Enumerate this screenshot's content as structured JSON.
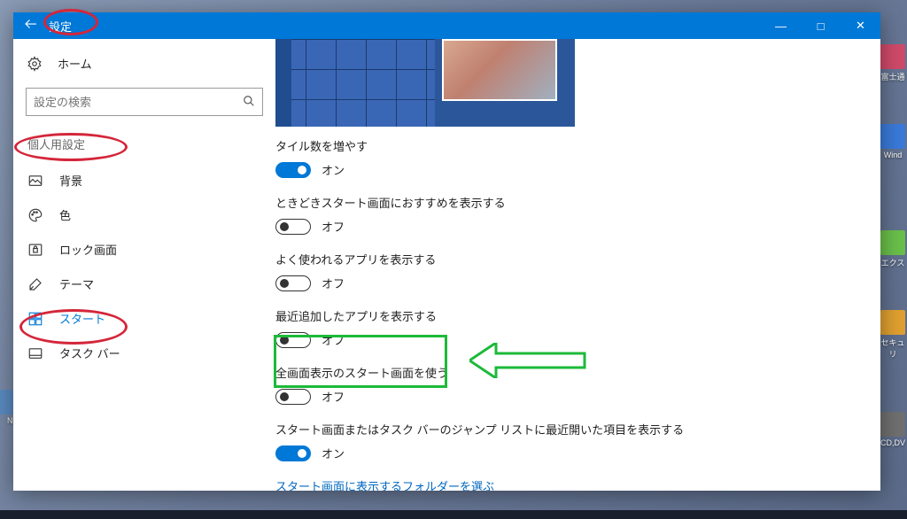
{
  "window": {
    "title": "設定",
    "controls": {
      "minimize": "—",
      "maximize": "□",
      "close": "✕"
    }
  },
  "sidebar": {
    "home": "ホーム",
    "search_placeholder": "設定の検索",
    "category": "個人用設定",
    "items": [
      {
        "label": "背景",
        "icon": "picture"
      },
      {
        "label": "色",
        "icon": "palette"
      },
      {
        "label": "ロック画面",
        "icon": "lock"
      },
      {
        "label": "テーマ",
        "icon": "theme"
      },
      {
        "label": "スタート",
        "icon": "start",
        "active": true
      },
      {
        "label": "タスク バー",
        "icon": "taskbar"
      }
    ]
  },
  "settings": [
    {
      "label": "タイル数を増やす",
      "value": true,
      "value_text": "オン"
    },
    {
      "label": "ときどきスタート画面におすすめを表示する",
      "value": false,
      "value_text": "オフ"
    },
    {
      "label": "よく使われるアプリを表示する",
      "value": false,
      "value_text": "オフ"
    },
    {
      "label": "最近追加したアプリを表示する",
      "value": false,
      "value_text": "オフ"
    },
    {
      "label": "全画面表示のスタート画面を使う",
      "value": false,
      "value_text": "オフ"
    },
    {
      "label": "スタート画面またはタスク バーのジャンプ リストに最近開いた項目を表示する",
      "value": true,
      "value_text": "オン"
    }
  ],
  "link": "スタート画面に表示するフォルダーを選ぶ",
  "desktop_icons": [
    "富士通",
    "Wind",
    "エクス",
    "セキュリ",
    "NT",
    "CD,DV"
  ]
}
